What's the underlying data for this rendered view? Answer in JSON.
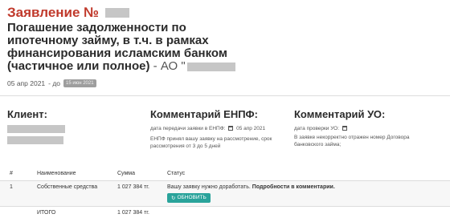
{
  "header": {
    "title": "Заявление №",
    "subject_line1": "Погашение задолженности по",
    "subject_line2": "ипотечному займу, в т.ч. в рамках",
    "subject_line3": "финансирования исламским банком",
    "subject_line4": "(частичное или полное)",
    "org_prefix": "- АО \"",
    "date_from": "05 апр 2021",
    "date_sep": "- до",
    "date_to": "15 июн 2021"
  },
  "client": {
    "heading": "Клиент:"
  },
  "enpf": {
    "heading": "Комментарий ЕНПФ:",
    "date_label": "дата передачи заявки в ЕНПФ:",
    "date_value": "05 апр 2021",
    "comment_line1": "ЕНПФ принял вашу заявку на рассмотрение, срок",
    "comment_line2": "рассмотрения от 3 до 5 дней"
  },
  "uo": {
    "heading": "Комментарий УО:",
    "date_label": "дата проверки УО:",
    "comment_line1": "В заявке некорректно отражен номер Договора",
    "comment_line2": "банковского займа;"
  },
  "table": {
    "headers": {
      "num": "#",
      "name": "Наименование",
      "sum": "Сумма",
      "status": "Статус"
    },
    "row1": {
      "num": "1",
      "name": "Собственные средства",
      "sum": "1 027 384 тг.",
      "status_text": "Вашу заявку нужно доработать.",
      "status_bold": "Подробности в комментарии.",
      "button_label": "ОБНОВИТЬ"
    },
    "total": {
      "name": "ИТОГО",
      "sum": "1 027 384 тг."
    }
  },
  "colors": {
    "title": "#c0392b",
    "button": "#2aa39b"
  },
  "icons": {
    "calendar": "calendar-icon",
    "refresh": "refresh-icon"
  }
}
